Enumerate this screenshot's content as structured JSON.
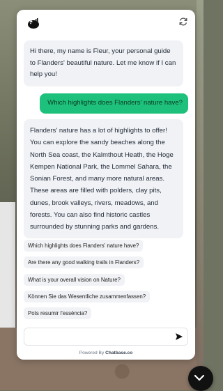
{
  "chat": {
    "messages": [
      {
        "role": "bot",
        "text": "Hi there, my name is Fleur, your personal guide to Flanders' beautiful nature. Let me know if I can help you!"
      },
      {
        "role": "user",
        "text": "Which highlights does Flanders' nature have?"
      },
      {
        "role": "bot",
        "text": "Flanders' nature has a lot of highlights to offer! You can explore the sandy beaches along the North Sea coast, the Kalmthout Heath, the Hoge Kempen National Park, the Lommel Sahara, the Sonian Forest, and many more natural areas. These areas are filled with polders, clay pits, dunes, brook valleys, rivers, meadows, and forests. You can also find historic castles surrounded by stunning parks and gardens."
      }
    ],
    "suggestions": [
      "Which highlights does Flanders' nature have?",
      "Are there any good walking trails in Flanders?",
      "What is your overall vision on Nature?",
      "Können Sie das Wesentliche zusammenfassen?",
      "Pots resumir l'essència?"
    ],
    "input_placeholder": "",
    "powered_prefix": "Powered By",
    "powered_brand": "Chatbase.co"
  },
  "icons": {
    "avatar": "badger-avatar-icon",
    "refresh": "refresh-icon",
    "send": "send-arrow-icon",
    "fab": "chevron-down-icon"
  },
  "colors": {
    "user_bubble": "#1ec17b",
    "bot_bubble": "#f1f2f5",
    "fab": "#111111"
  }
}
